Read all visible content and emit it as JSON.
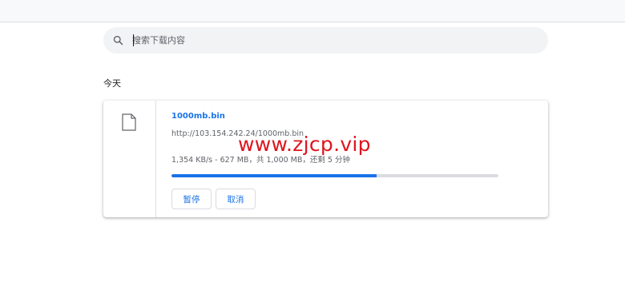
{
  "search": {
    "placeholder": "搜索下载内容"
  },
  "section": {
    "label": "今天"
  },
  "download": {
    "file_name": "1000mb.bin",
    "url": "http://103.154.242.24/1000mb.bin",
    "status": "1,354 KB/s - 627 MB，共 1,000 MB，还剩 5 分钟",
    "progress_fraction": 0.627,
    "pause_label": "暂停",
    "cancel_label": "取消"
  },
  "watermark": {
    "text": "www.zjcp.vip"
  },
  "colors": {
    "accent": "#1a73e8",
    "watermark": "#e0141e",
    "track": "#dadce0"
  },
  "icons": {
    "search": "search-icon",
    "file": "file-icon"
  }
}
